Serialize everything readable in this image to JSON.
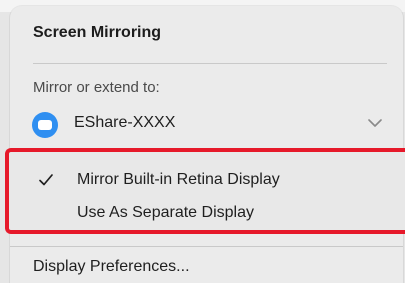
{
  "menu": {
    "title": "Screen Mirroring",
    "section_label": "Mirror or extend to:",
    "device": {
      "name": "EShare-XXXX",
      "icon": "apple-tv-icon",
      "icon_color": "#2f8ff1"
    },
    "options": [
      {
        "label": "Mirror Built-in Retina Display",
        "checked": true
      },
      {
        "label": "Use As Separate Display",
        "checked": false
      }
    ],
    "preferences_label": "Display Preferences...",
    "highlight_color": "#e6192a"
  }
}
